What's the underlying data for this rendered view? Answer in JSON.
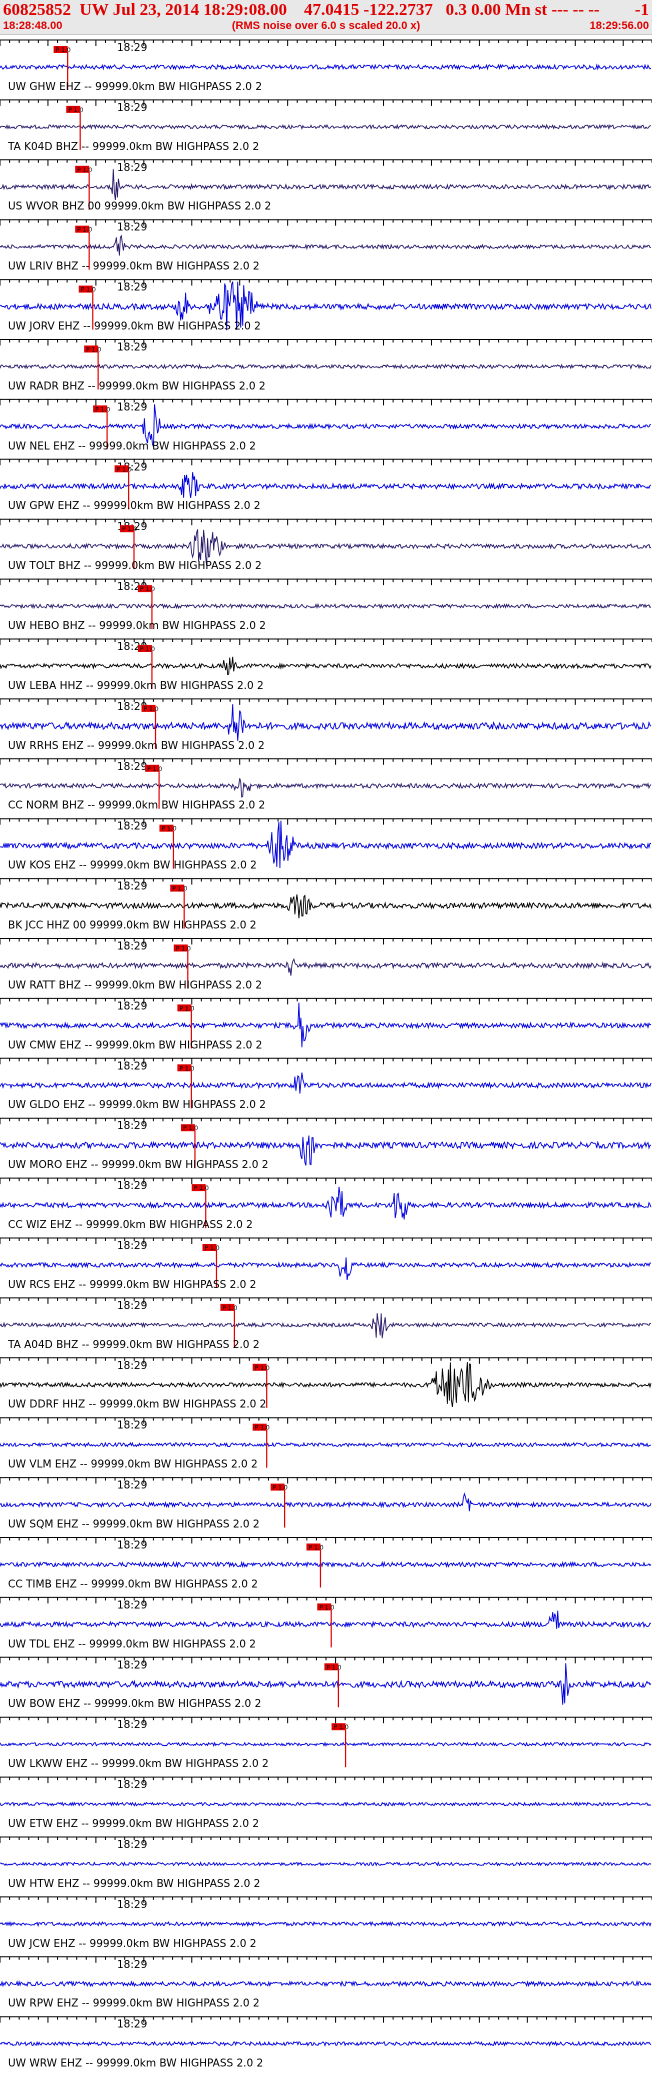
{
  "header": {
    "event_id": "60825852",
    "network": "UW",
    "date": "Jul 23, 2014",
    "origin_time": "18:29:08.00",
    "latitude": "47.0415",
    "longitude": "-122.2737",
    "depth": "0.3",
    "magnitude": "0.00",
    "mag_type": "Mn",
    "status": "st --- -- --",
    "right_flag": "-1",
    "start_time": "18:28:48.00",
    "end_time": "18:29:56.00",
    "note": "(RMS noise over 6.0 s scaled 20.0 x)"
  },
  "colors": {
    "header_text": "#e00000",
    "header_bg": "#e8e8e8",
    "trace_blue": "#0000e0",
    "trace_dark": "#2a1a6a",
    "trace_black": "#000000",
    "pick_marker": "#e00000"
  },
  "time_label": "18:29",
  "pick_label": "P 1.0",
  "traces": [
    {
      "label": "UW GHW EHZ -- 99999.0km BW  HIGHPASS  2.0  2",
      "pick": 0.21,
      "env": [],
      "color": "blue",
      "noise": 0.35
    },
    {
      "label": "TA K04D BHZ -- 99999.0km BW  HIGHPASS  2.0  2",
      "pick": 0.28,
      "env": [],
      "color": "dark",
      "noise": 0.3
    },
    {
      "label": "US WVOR BHZ 00 99999.0km BW  HIGHPASS  2.0  2",
      "pick": 0.33,
      "env": [
        [
          0.34,
          0.38,
          0.8
        ]
      ],
      "color": "dark",
      "noise": 0.35
    },
    {
      "label": "UW LRIV BHZ -- 99999.0km BW  HIGHPASS  2.0  2",
      "pick": 0.33,
      "env": [
        [
          0.35,
          0.4,
          0.6
        ]
      ],
      "color": "dark",
      "noise": 0.3
    },
    {
      "label": "UW JORV EHZ -- 99999.0km BW  HIGHPASS  2.0  2",
      "pick": 0.35,
      "env": [
        [
          0.54,
          0.6,
          0.8
        ],
        [
          0.64,
          0.88,
          1.0
        ]
      ],
      "color": "blue",
      "noise": 0.45
    },
    {
      "label": "UW RADR BHZ -- 99999.0km BW  HIGHPASS  2.0  2",
      "pick": 0.38,
      "env": [],
      "color": "dark",
      "noise": 0.3
    },
    {
      "label": "UW NEL EHZ -- 99999.0km BW  HIGHPASS  2.0  2",
      "pick": 0.43,
      "env": [
        [
          0.44,
          0.52,
          1.0
        ]
      ],
      "color": "blue",
      "noise": 0.35
    },
    {
      "label": "UW GPW EHZ -- 99999.0km BW  HIGHPASS  2.0  2",
      "pick": 0.55,
      "env": [
        [
          0.55,
          0.65,
          0.6
        ]
      ],
      "color": "blue",
      "noise": 0.4
    },
    {
      "label": "UW TOLT BHZ -- 99999.0km BW  HIGHPASS  2.0  2",
      "pick": 0.58,
      "env": [
        [
          0.58,
          0.75,
          0.8
        ]
      ],
      "color": "dark",
      "noise": 0.35
    },
    {
      "label": "UW HEBO BHZ -- 99999.0km BW  HIGHPASS  2.0  2",
      "pick": 0.68,
      "env": [],
      "color": "dark",
      "noise": 0.3
    },
    {
      "label": "UW LEBA HHZ -- 99999.0km BW  HIGHPASS  2.0  2",
      "pick": 0.68,
      "env": [
        [
          0.68,
          0.76,
          0.4
        ]
      ],
      "color": "black",
      "noise": 0.35
    },
    {
      "label": "UW RRHS EHZ -- 99999.0km BW  HIGHPASS  2.0  2",
      "pick": 0.7,
      "env": [
        [
          0.7,
          0.78,
          1.0
        ]
      ],
      "color": "blue",
      "noise": 0.55
    },
    {
      "label": "CC NORM BHZ -- 99999.0km BW  HIGHPASS  2.0  2",
      "pick": 0.72,
      "env": [
        [
          0.72,
          0.8,
          0.5
        ]
      ],
      "color": "dark",
      "noise": 0.35
    },
    {
      "label": "UW KOS EHZ -- 99999.0km BW  HIGHPASS  2.0  2",
      "pick": 0.8,
      "env": [
        [
          0.82,
          0.95,
          1.0
        ]
      ],
      "color": "blue",
      "noise": 0.45
    },
    {
      "label": "BK JCC HHZ 00 99999.0km BW  HIGHPASS  2.0  2",
      "pick": 0.86,
      "env": [
        [
          0.88,
          1.0,
          0.5
        ]
      ],
      "color": "black",
      "noise": 0.45
    },
    {
      "label": "UW RATT BHZ -- 99999.0km BW  HIGHPASS  2.0  2",
      "pick": 0.88,
      "env": [
        [
          0.88,
          0.92,
          0.5
        ]
      ],
      "color": "dark",
      "noise": 0.4
    },
    {
      "label": "UW CMW EHZ -- 99999.0km BW  HIGHPASS  2.0  2",
      "pick": 0.9,
      "env": [
        [
          0.9,
          0.98,
          1.0
        ]
      ],
      "color": "blue",
      "noise": 0.4
    },
    {
      "label": "UW GLDO EHZ -- 99999.0km BW  HIGHPASS  2.0  2",
      "pick": 0.9,
      "env": [
        [
          0.9,
          0.96,
          0.6
        ]
      ],
      "color": "blue",
      "noise": 0.4
    },
    {
      "label": "UW MORO EHZ -- 99999.0km BW  HIGHPASS  2.0  2",
      "pick": 0.92,
      "env": [
        [
          0.92,
          1.0,
          1.0
        ]
      ],
      "color": "blue",
      "noise": 0.5
    },
    {
      "label": "CC WIZ EHZ -- 99999.0km BW  HIGHPASS  2.0  2",
      "pick": 0.98,
      "env": [
        [
          1.0,
          1.1,
          0.8
        ],
        [
          1.2,
          1.28,
          0.9
        ]
      ],
      "color": "blue",
      "noise": 0.4
    },
    {
      "label": "UW RCS EHZ -- 99999.0km BW  HIGHPASS  2.0  2",
      "pick": 1.04,
      "env": [
        [
          1.04,
          1.1,
          0.9
        ]
      ],
      "color": "blue",
      "noise": 0.35
    },
    {
      "label": "TA A04D BHZ -- 99999.0km BW  HIGHPASS  2.0  2",
      "pick": 1.14,
      "env": [
        [
          1.14,
          1.22,
          0.6
        ]
      ],
      "color": "dark",
      "noise": 0.3
    },
    {
      "label": "UW DDRF HHZ -- 99999.0km BW  HIGHPASS  2.0  2",
      "pick": 1.32,
      "env": [
        [
          1.32,
          1.6,
          1.0
        ]
      ],
      "color": "black",
      "noise": 0.35
    },
    {
      "label": "UW VLM EHZ -- 99999.0km BW  HIGHPASS  2.0  2",
      "pick": 1.32,
      "env": [],
      "color": "blue",
      "noise": 0.3
    },
    {
      "label": "UW SQM EHZ -- 99999.0km BW  HIGHPASS  2.0  2",
      "pick": 1.42,
      "env": [
        [
          1.42,
          1.46,
          0.6
        ]
      ],
      "color": "blue",
      "noise": 0.35
    },
    {
      "label": "CC TIMB EHZ -- 99999.0km BW  HIGHPASS  2.0  2",
      "pick": 1.62,
      "env": [],
      "color": "blue",
      "noise": 0.35
    },
    {
      "label": "UW TDL EHZ -- 99999.0km BW  HIGHPASS  2.0  2",
      "pick": 1.68,
      "env": [
        [
          1.68,
          1.74,
          0.9
        ]
      ],
      "color": "blue",
      "noise": 0.4
    },
    {
      "label": "UW BOW EHZ -- 99999.0km BW  HIGHPASS  2.0  2",
      "pick": 1.72,
      "env": [
        [
          1.72,
          1.76,
          1.0
        ]
      ],
      "color": "blue",
      "noise": 0.5
    },
    {
      "label": "UW LKWW EHZ -- 99999.0km BW  HIGHPASS  2.0  2",
      "pick": 1.76,
      "env": [],
      "color": "blue",
      "noise": 0.25
    },
    {
      "label": "UW ETW EHZ -- 99999.0km BW  HIGHPASS  2.0  2",
      "pick": null,
      "env": [],
      "color": "blue",
      "noise": 0.25
    },
    {
      "label": "UW HTW EHZ -- 99999.0km BW  HIGHPASS  2.0  2",
      "pick": null,
      "env": [],
      "color": "blue",
      "noise": 0.25
    },
    {
      "label": "UW JCW EHZ -- 99999.0km BW  HIGHPASS  2.0  2",
      "pick": null,
      "env": [],
      "color": "blue",
      "noise": 0.3
    },
    {
      "label": "UW RPW EHZ -- 99999.0km BW  HIGHPASS  2.0  2",
      "pick": null,
      "env": [],
      "color": "blue",
      "noise": 0.35
    },
    {
      "label": "UW WRW EHZ -- 99999.0km BW  HIGHPASS  2.0  2",
      "pick": null,
      "env": [],
      "color": "blue",
      "noise": 0.3
    }
  ]
}
